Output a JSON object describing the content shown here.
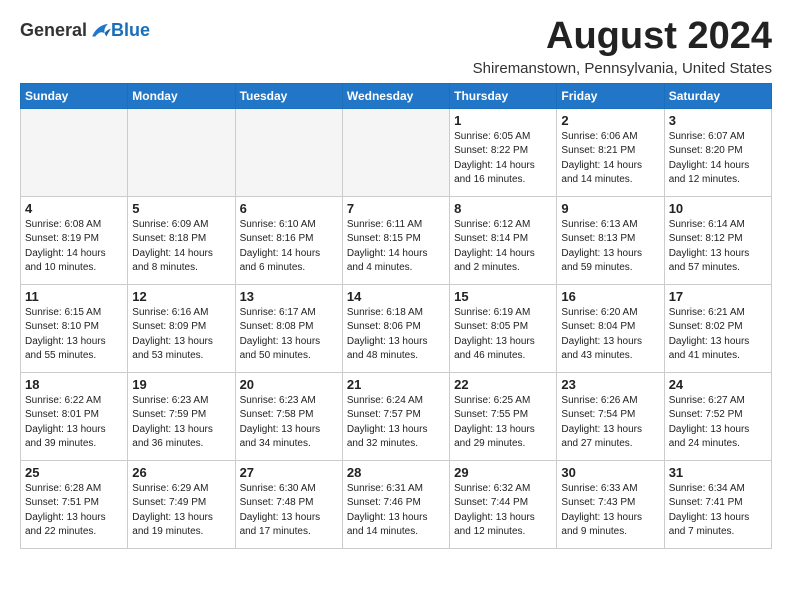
{
  "logo": {
    "general": "General",
    "blue": "Blue"
  },
  "title": {
    "month_year": "August 2024",
    "location": "Shiremanstown, Pennsylvania, United States"
  },
  "weekdays": [
    "Sunday",
    "Monday",
    "Tuesday",
    "Wednesday",
    "Thursday",
    "Friday",
    "Saturday"
  ],
  "weeks": [
    [
      {
        "day": "",
        "info": ""
      },
      {
        "day": "",
        "info": ""
      },
      {
        "day": "",
        "info": ""
      },
      {
        "day": "",
        "info": ""
      },
      {
        "day": "1",
        "info": "Sunrise: 6:05 AM\nSunset: 8:22 PM\nDaylight: 14 hours and 16 minutes."
      },
      {
        "day": "2",
        "info": "Sunrise: 6:06 AM\nSunset: 8:21 PM\nDaylight: 14 hours and 14 minutes."
      },
      {
        "day": "3",
        "info": "Sunrise: 6:07 AM\nSunset: 8:20 PM\nDaylight: 14 hours and 12 minutes."
      }
    ],
    [
      {
        "day": "4",
        "info": "Sunrise: 6:08 AM\nSunset: 8:19 PM\nDaylight: 14 hours and 10 minutes."
      },
      {
        "day": "5",
        "info": "Sunrise: 6:09 AM\nSunset: 8:18 PM\nDaylight: 14 hours and 8 minutes."
      },
      {
        "day": "6",
        "info": "Sunrise: 6:10 AM\nSunset: 8:16 PM\nDaylight: 14 hours and 6 minutes."
      },
      {
        "day": "7",
        "info": "Sunrise: 6:11 AM\nSunset: 8:15 PM\nDaylight: 14 hours and 4 minutes."
      },
      {
        "day": "8",
        "info": "Sunrise: 6:12 AM\nSunset: 8:14 PM\nDaylight: 14 hours and 2 minutes."
      },
      {
        "day": "9",
        "info": "Sunrise: 6:13 AM\nSunset: 8:13 PM\nDaylight: 13 hours and 59 minutes."
      },
      {
        "day": "10",
        "info": "Sunrise: 6:14 AM\nSunset: 8:12 PM\nDaylight: 13 hours and 57 minutes."
      }
    ],
    [
      {
        "day": "11",
        "info": "Sunrise: 6:15 AM\nSunset: 8:10 PM\nDaylight: 13 hours and 55 minutes."
      },
      {
        "day": "12",
        "info": "Sunrise: 6:16 AM\nSunset: 8:09 PM\nDaylight: 13 hours and 53 minutes."
      },
      {
        "day": "13",
        "info": "Sunrise: 6:17 AM\nSunset: 8:08 PM\nDaylight: 13 hours and 50 minutes."
      },
      {
        "day": "14",
        "info": "Sunrise: 6:18 AM\nSunset: 8:06 PM\nDaylight: 13 hours and 48 minutes."
      },
      {
        "day": "15",
        "info": "Sunrise: 6:19 AM\nSunset: 8:05 PM\nDaylight: 13 hours and 46 minutes."
      },
      {
        "day": "16",
        "info": "Sunrise: 6:20 AM\nSunset: 8:04 PM\nDaylight: 13 hours and 43 minutes."
      },
      {
        "day": "17",
        "info": "Sunrise: 6:21 AM\nSunset: 8:02 PM\nDaylight: 13 hours and 41 minutes."
      }
    ],
    [
      {
        "day": "18",
        "info": "Sunrise: 6:22 AM\nSunset: 8:01 PM\nDaylight: 13 hours and 39 minutes."
      },
      {
        "day": "19",
        "info": "Sunrise: 6:23 AM\nSunset: 7:59 PM\nDaylight: 13 hours and 36 minutes."
      },
      {
        "day": "20",
        "info": "Sunrise: 6:23 AM\nSunset: 7:58 PM\nDaylight: 13 hours and 34 minutes."
      },
      {
        "day": "21",
        "info": "Sunrise: 6:24 AM\nSunset: 7:57 PM\nDaylight: 13 hours and 32 minutes."
      },
      {
        "day": "22",
        "info": "Sunrise: 6:25 AM\nSunset: 7:55 PM\nDaylight: 13 hours and 29 minutes."
      },
      {
        "day": "23",
        "info": "Sunrise: 6:26 AM\nSunset: 7:54 PM\nDaylight: 13 hours and 27 minutes."
      },
      {
        "day": "24",
        "info": "Sunrise: 6:27 AM\nSunset: 7:52 PM\nDaylight: 13 hours and 24 minutes."
      }
    ],
    [
      {
        "day": "25",
        "info": "Sunrise: 6:28 AM\nSunset: 7:51 PM\nDaylight: 13 hours and 22 minutes."
      },
      {
        "day": "26",
        "info": "Sunrise: 6:29 AM\nSunset: 7:49 PM\nDaylight: 13 hours and 19 minutes."
      },
      {
        "day": "27",
        "info": "Sunrise: 6:30 AM\nSunset: 7:48 PM\nDaylight: 13 hours and 17 minutes."
      },
      {
        "day": "28",
        "info": "Sunrise: 6:31 AM\nSunset: 7:46 PM\nDaylight: 13 hours and 14 minutes."
      },
      {
        "day": "29",
        "info": "Sunrise: 6:32 AM\nSunset: 7:44 PM\nDaylight: 13 hours and 12 minutes."
      },
      {
        "day": "30",
        "info": "Sunrise: 6:33 AM\nSunset: 7:43 PM\nDaylight: 13 hours and 9 minutes."
      },
      {
        "day": "31",
        "info": "Sunrise: 6:34 AM\nSunset: 7:41 PM\nDaylight: 13 hours and 7 minutes."
      }
    ]
  ]
}
